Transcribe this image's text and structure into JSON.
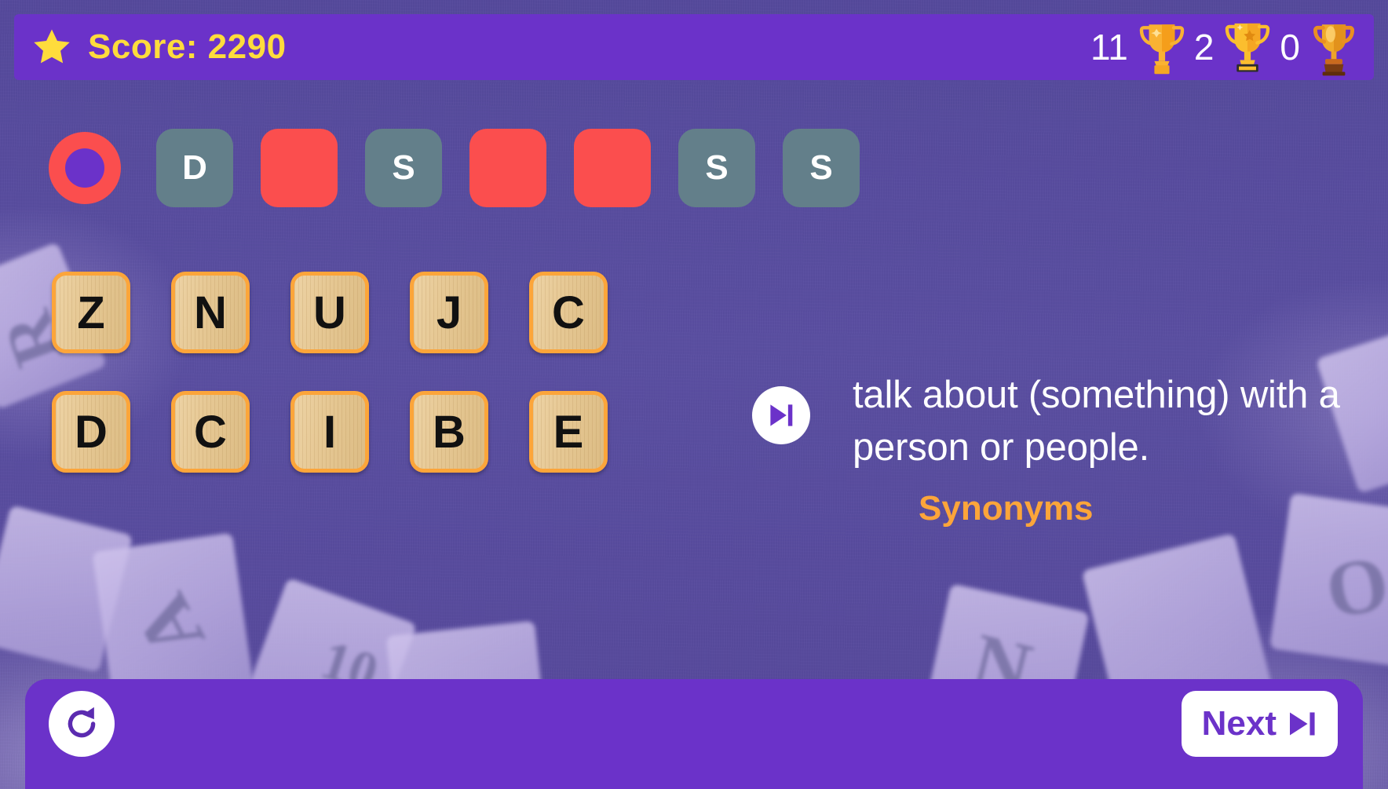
{
  "header": {
    "star_icon": "star-icon",
    "score_label": "Score: 2290",
    "trophies": [
      {
        "count": "11",
        "icon": "trophy-gold-icon"
      },
      {
        "count": "2",
        "icon": "trophy-star-icon"
      },
      {
        "count": "0",
        "icon": "trophy-bronze-icon"
      }
    ]
  },
  "puzzle": {
    "indicator_icon": "current-slot-indicator",
    "slots": [
      {
        "letter": "D",
        "state": "filled"
      },
      {
        "letter": "",
        "state": "empty"
      },
      {
        "letter": "S",
        "state": "filled"
      },
      {
        "letter": "",
        "state": "empty"
      },
      {
        "letter": "",
        "state": "empty"
      },
      {
        "letter": "S",
        "state": "filled"
      },
      {
        "letter": "S",
        "state": "filled"
      }
    ]
  },
  "tiles": {
    "row1": [
      "Z",
      "N",
      "U",
      "J",
      "C"
    ],
    "row2": [
      "D",
      "C",
      "I",
      "B",
      "E"
    ]
  },
  "clue": {
    "speak_icon": "skip-play-icon",
    "definition": "talk about (something) with a person or people.",
    "synonyms_label": "Synonyms"
  },
  "footer": {
    "restart_icon": "refresh-icon",
    "next_label": "Next",
    "next_icon": "skip-play-icon"
  },
  "colors": {
    "header_purple": "#6b32c9",
    "background_purple": "#5a4ea0",
    "score_yellow": "#ffdc3c",
    "slot_filled_gray": "#637f8a",
    "slot_empty_red": "#fb4e4e",
    "tile_border_orange": "#fca53a",
    "accent_orange": "#fca53a"
  }
}
